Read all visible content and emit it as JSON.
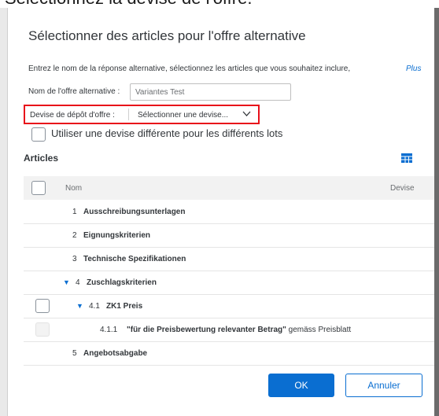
{
  "caption": "Sélectionnez la devise de l'offre.",
  "dialog": {
    "title": "Sélectionner des articles pour l'offre alternative",
    "intro": "Entrez le nom de la réponse alternative, sélectionnez les articles que vous souhaitez inclure,",
    "intro_more": "Plus",
    "name_label": "Nom de l'offre alternative :",
    "name_value": "Variantes Test",
    "currency_label": "Devise de dépôt d'offre :",
    "currency_placeholder": "Sélectionner une devise...",
    "diff_currency_label": "Utiliser une devise différente pour les différents lots",
    "section_title": "Articles",
    "columns": {
      "name": "Nom",
      "currency": "Devise"
    },
    "rows": [
      {
        "num": "1",
        "text": "Ausschreibungsunterlagen"
      },
      {
        "num": "2",
        "text": "Eignungskriterien"
      },
      {
        "num": "3",
        "text": "Technische Spezifikationen"
      },
      {
        "num": "4",
        "text": "Zuschlagskriterien"
      },
      {
        "num": "4.1",
        "text": "ZK1 Preis"
      },
      {
        "num": "4.1.1",
        "text": "\"für die Preisbewertung relevanter Betrag\"",
        "suffix": "gemäss Preisblatt"
      },
      {
        "num": "5",
        "text": "Angebotsabgabe"
      }
    ],
    "ok_label": "OK",
    "cancel_label": "Annuler"
  },
  "icons": {
    "currency_chevron": "chevron-down-icon",
    "grid": "table-settings-icon",
    "expand": "triangle-down-icon"
  },
  "colors": {
    "accent": "#0a6ed1",
    "highlight": "#e8101a"
  }
}
